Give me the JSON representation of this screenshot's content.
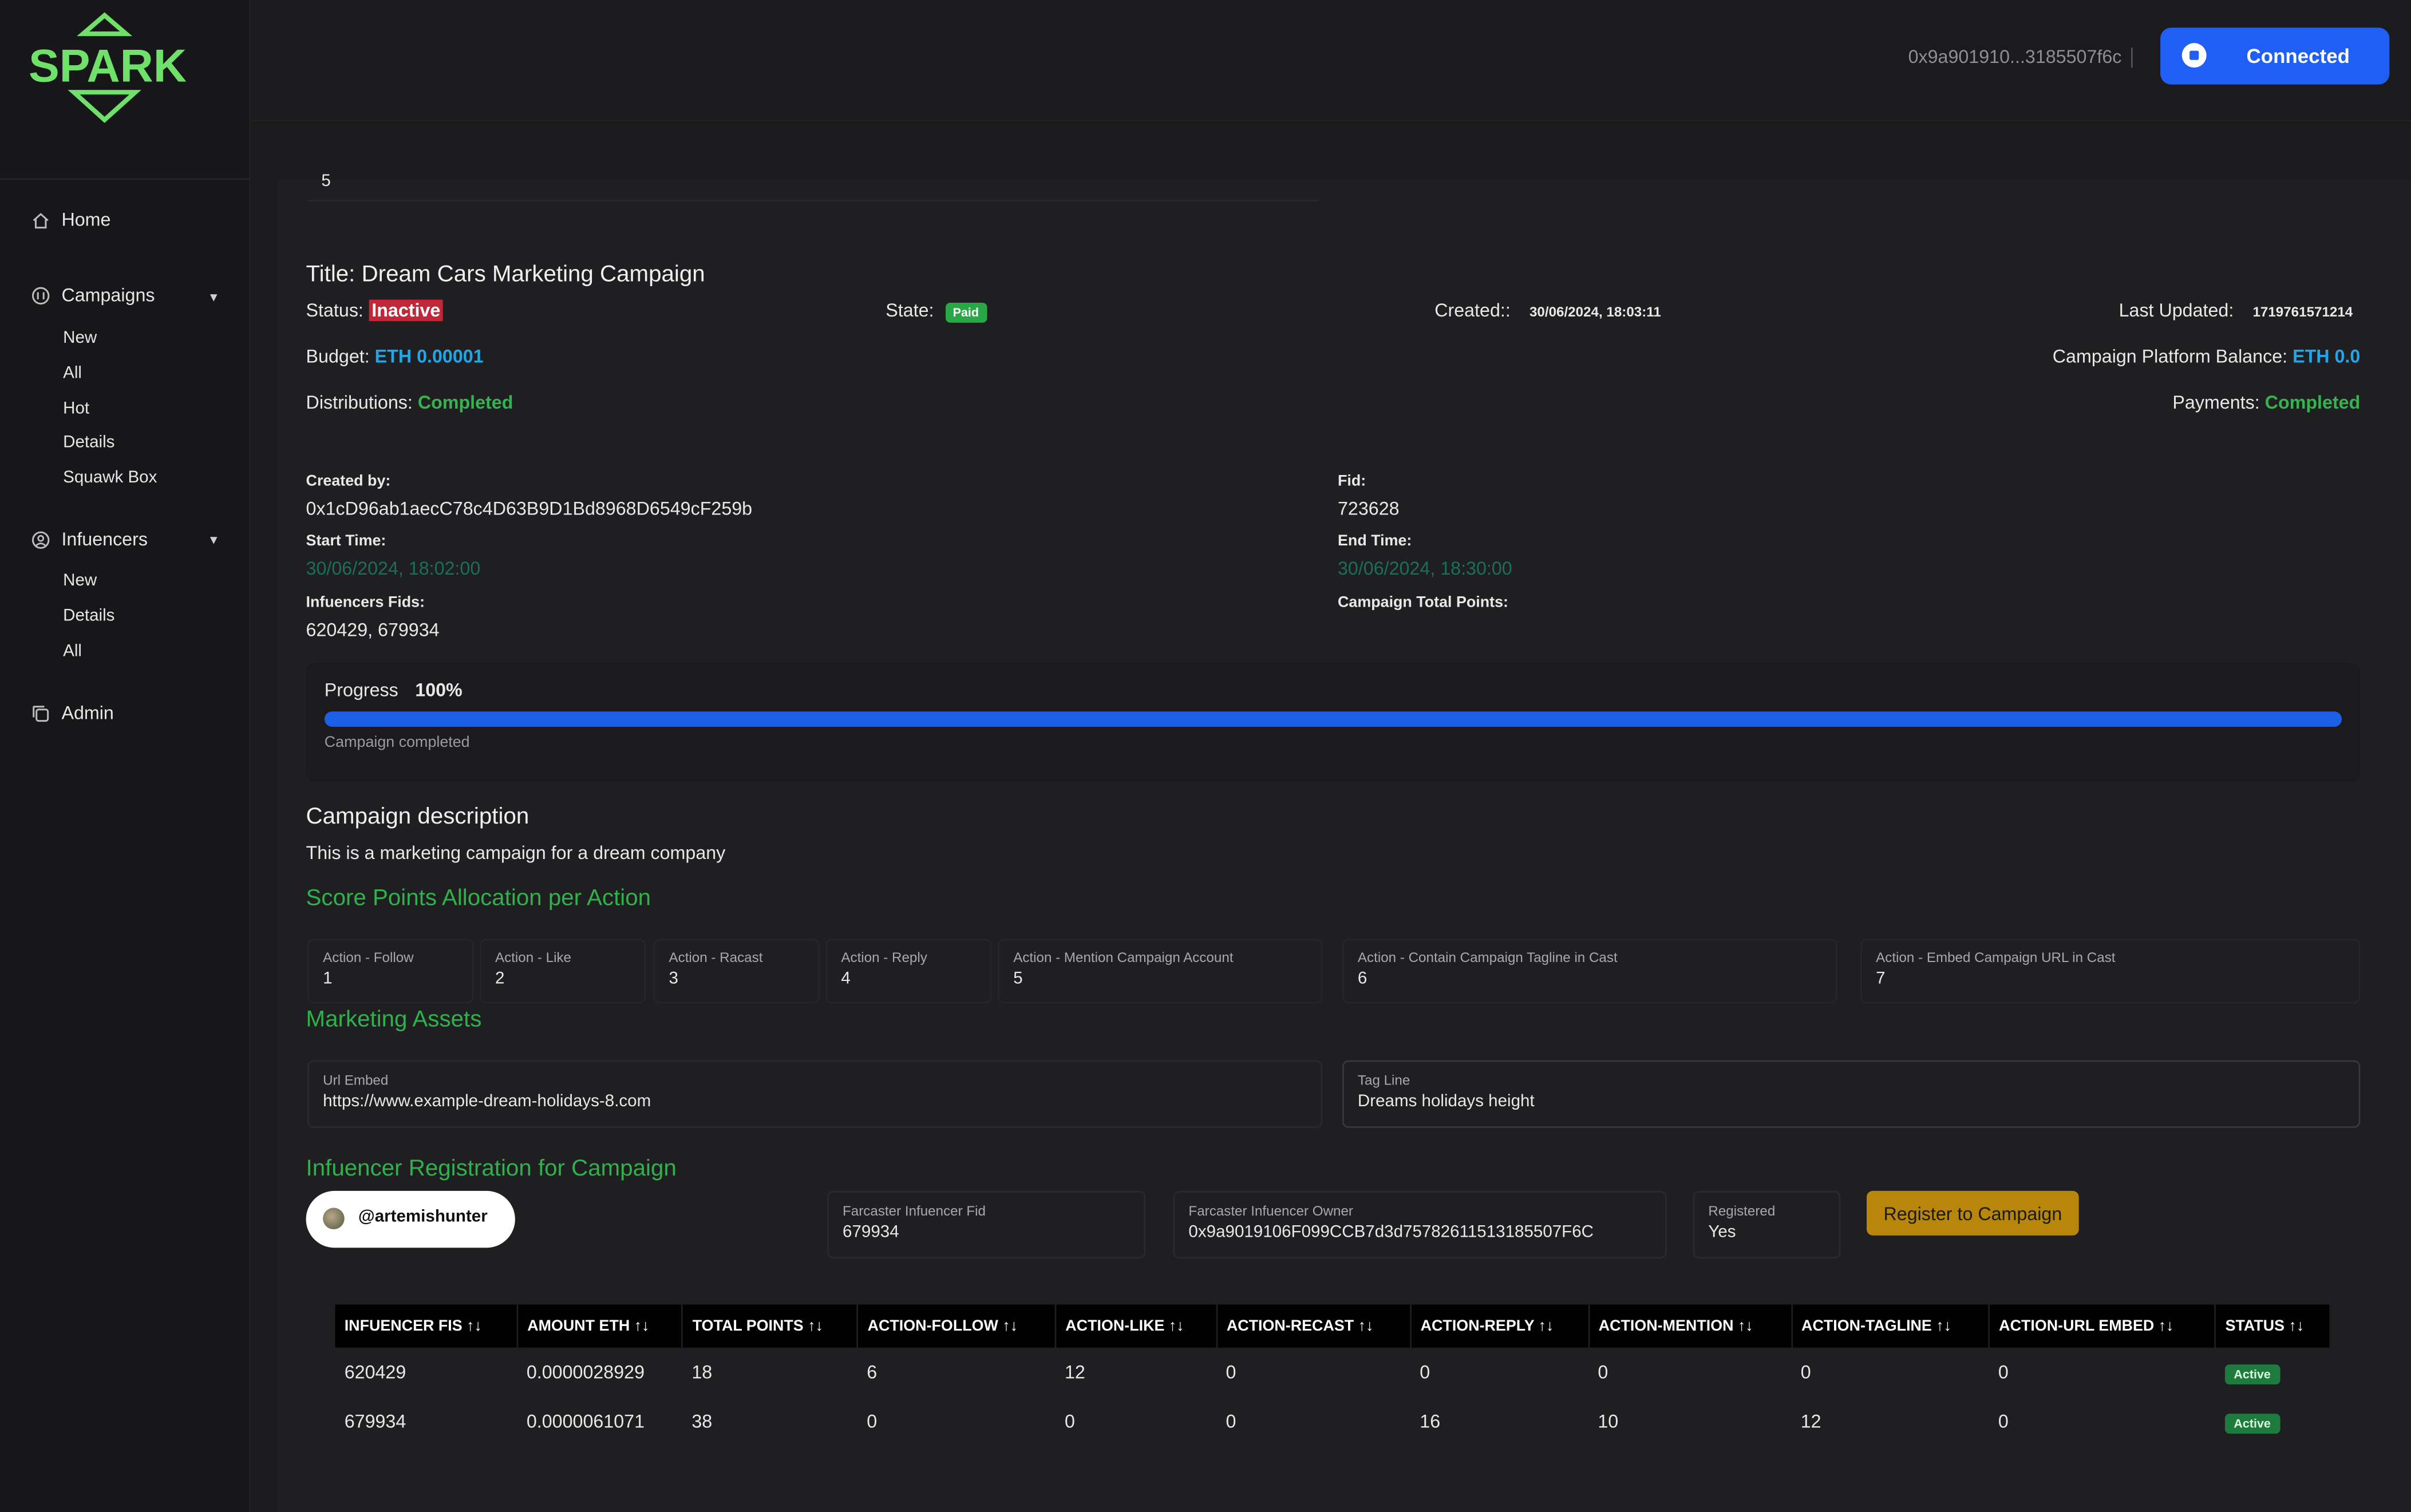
{
  "logo_text": "SPARK",
  "sidebar": {
    "home": "Home",
    "campaigns": {
      "label": "Campaigns",
      "items": [
        "New",
        "All",
        "Hot",
        "Details",
        "Squawk Box"
      ]
    },
    "influencers": {
      "label": "Infuencers",
      "items": [
        "New",
        "Details",
        "All"
      ]
    },
    "admin": "Admin"
  },
  "topbar": {
    "wallet": "0x9a901910...3185507f6c",
    "connect_label": "Connected"
  },
  "campaign": {
    "cut_value": "5",
    "title": "Title: Dream Cars Marketing Campaign",
    "status_label": "Status:",
    "status_value": "Inactive",
    "state_label": "State:",
    "state_value": "Paid",
    "created_label": "Created::",
    "created_value": "30/06/2024, 18:03:11",
    "updated_label": "Last Updated:",
    "updated_value": "1719761571214",
    "budget_label": "Budget:",
    "budget_value": "ETH 0.00001",
    "balance_label": "Campaign Platform Balance:",
    "balance_value": "ETH 0.0",
    "distributions_label": "Distributions:",
    "distributions_value": "Completed",
    "payments_label": "Payments:",
    "payments_value": "Completed",
    "created_by_label": "Created by:",
    "created_by_value": "0x1cD96ab1aecC78c4D63B9D1Bd8968D6549cF259b",
    "fid_label": "Fid:",
    "fid_value": "723628",
    "start_label": "Start Time:",
    "start_value": "30/06/2024, 18:02:00",
    "end_label": "End Time:",
    "end_value": "30/06/2024, 18:30:00",
    "inf_fids_label": "Infuencers Fids:",
    "inf_fids_value": "620429, 679934",
    "total_points_label": "Campaign Total Points:"
  },
  "progress": {
    "label": "Progress",
    "percent_text": "100%",
    "value": 1.0,
    "caption": "Campaign completed"
  },
  "description": {
    "heading": "Campaign description",
    "text": "This is a marketing campaign for a dream company"
  },
  "score": {
    "heading": "Score Points Allocation per Action",
    "actions": [
      {
        "label": "Action - Follow",
        "value": "1"
      },
      {
        "label": "Action - Like",
        "value": "2"
      },
      {
        "label": "Action - Racast",
        "value": "3"
      },
      {
        "label": "Action - Reply",
        "value": "4"
      },
      {
        "label": "Action - Mention Campaign Account",
        "value": "5"
      },
      {
        "label": "Action - Contain Campaign Tagline in Cast",
        "value": "6"
      },
      {
        "label": "Action - Embed Campaign URL in Cast",
        "value": "7"
      }
    ]
  },
  "assets": {
    "heading": "Marketing Assets",
    "url_label": "Url Embed",
    "url_value": "https://www.example-dream-holidays-8.com",
    "tag_label": "Tag Line",
    "tag_value": "Dreams holidays height"
  },
  "registration": {
    "heading": "Infuencer Registration for Campaign",
    "username": "@artemishunter",
    "fid_label": "Farcaster Infuencer Fid",
    "fid_value": "679934",
    "owner_label": "Farcaster Infuencer Owner",
    "owner_value": "0x9a9019106F099CCB7d3d75782611513185507F6C",
    "registered_label": "Registered",
    "registered_value": "Yes",
    "register_button": "Register to Campaign"
  },
  "table": {
    "headers": [
      "INFUENCER FIS ↑↓",
      "AMOUNT ETH ↑↓",
      "TOTAL POINTS ↑↓",
      "ACTION-FOLLOW ↑↓",
      "ACTION-LIKE ↑↓",
      "ACTION-RECAST ↑↓",
      "ACTION-REPLY ↑↓",
      "ACTION-MENTION ↑↓",
      "ACTION-TAGLINE ↑↓",
      "ACTION-URL EMBED ↑↓",
      "STATUS ↑↓"
    ],
    "rows": [
      [
        "620429",
        "0.0000028929",
        "18",
        "6",
        "12",
        "0",
        "0",
        "0",
        "0",
        "0",
        "Active"
      ],
      [
        "679934",
        "0.0000061071",
        "38",
        "0",
        "0",
        "0",
        "16",
        "10",
        "12",
        "0",
        "Active"
      ]
    ]
  },
  "colors": {
    "accent_green": "#34b34f",
    "accent_blue": "#23a6e8",
    "button_blue": "#1f5ff5",
    "register_gold": "#b8860b",
    "inactive_red": "#c0283a"
  }
}
